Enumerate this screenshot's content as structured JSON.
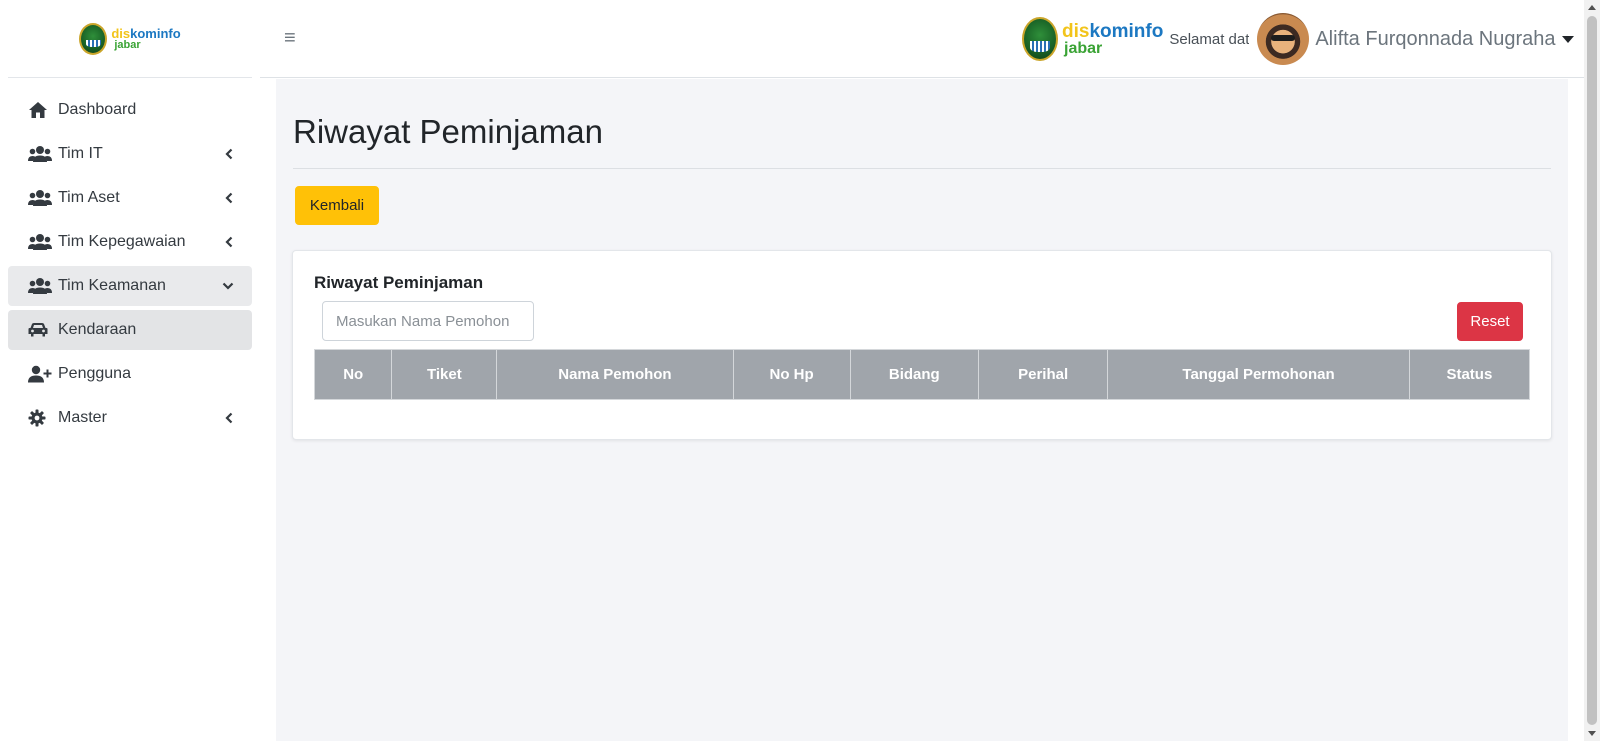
{
  "brand": {
    "logo_dis": "dis",
    "logo_kominfo": "kominfo",
    "logo_jabar": "jabar",
    "icon": "west-java-seal-icon"
  },
  "sidebar": {
    "items": [
      {
        "label": "Dashboard",
        "icon": "home-icon",
        "has_chevron": false,
        "state": "normal"
      },
      {
        "label": "Tim IT",
        "icon": "users-icon",
        "has_chevron": true,
        "chevron": "left",
        "state": "normal"
      },
      {
        "label": "Tim Aset",
        "icon": "users-icon",
        "has_chevron": true,
        "chevron": "left",
        "state": "normal"
      },
      {
        "label": "Tim Kepegawaian",
        "icon": "users-icon",
        "has_chevron": true,
        "chevron": "left",
        "state": "normal"
      },
      {
        "label": "Tim Keamanan",
        "icon": "users-icon",
        "has_chevron": true,
        "chevron": "down",
        "state": "open"
      },
      {
        "label": "Kendaraan",
        "icon": "car-icon",
        "has_chevron": false,
        "state": "active-sub"
      },
      {
        "label": "Pengguna",
        "icon": "user-plus-icon",
        "has_chevron": false,
        "state": "normal"
      },
      {
        "label": "Master",
        "icon": "gear-icon",
        "has_chevron": true,
        "chevron": "left",
        "state": "normal"
      }
    ]
  },
  "topbar": {
    "menu_icon": "≡",
    "welcome": "Selamat datang",
    "user_name": "Alifta Furqonnada Nugraha"
  },
  "main": {
    "page_title": "Riwayat Peminjaman",
    "back_button": "Kembali",
    "card": {
      "title": "Riwayat Peminjaman",
      "search_placeholder": "Masukan Nama Pemohon",
      "search_value": "",
      "reset_button": "Reset",
      "table": {
        "columns": [
          "No",
          "Tiket",
          "Nama Pemohon",
          "No Hp",
          "Bidang",
          "Perihal",
          "Tanggal Permohonan",
          "Status"
        ],
        "rows": []
      }
    }
  },
  "colors": {
    "warning": "#ffc107",
    "danger": "#dc3545",
    "table_header": "#a0a5ab",
    "content_bg": "#f4f5f8"
  }
}
